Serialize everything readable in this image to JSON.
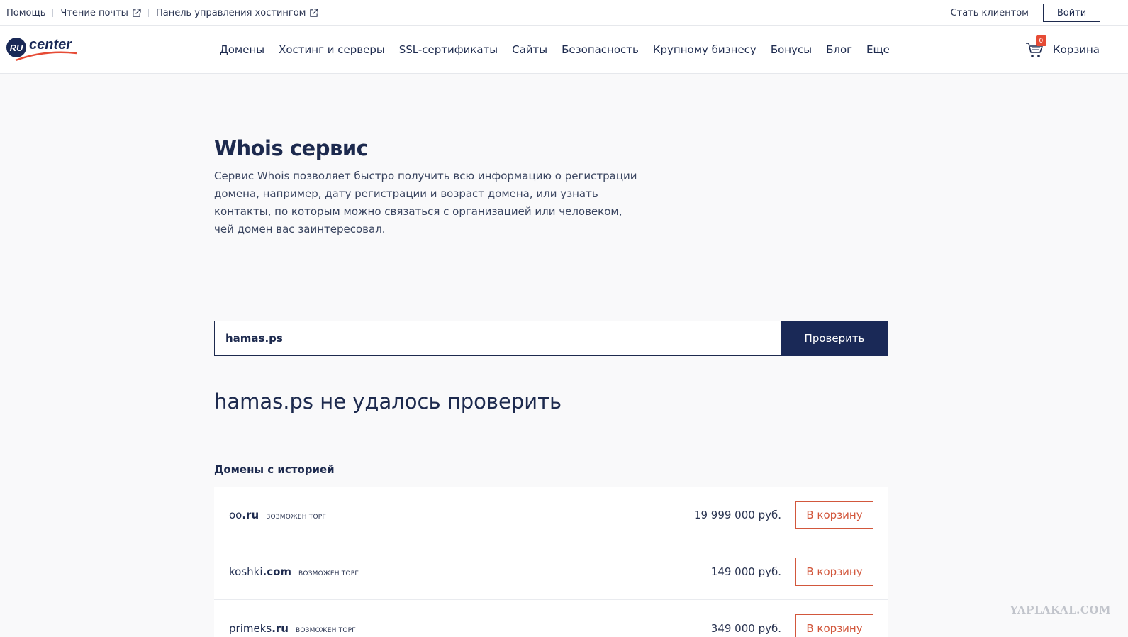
{
  "topbar": {
    "help": "Помощь",
    "mail": "Чтение почты",
    "hosting_panel": "Панель управления хостингом",
    "become_client": "Стать клиентом",
    "login": "Войти"
  },
  "logo": {
    "ru": "RU",
    "center": "center"
  },
  "nav": [
    "Домены",
    "Хостинг и серверы",
    "SSL-сертификаты",
    "Сайты",
    "Безопасность",
    "Крупному бизнесу",
    "Бонусы",
    "Блог",
    "Еще"
  ],
  "cart": {
    "label": "Корзина",
    "count": "0"
  },
  "page": {
    "title": "Whois сервис",
    "description": "Сервис Whois позволяет быстро получить всю информацию о регистрации домена, например, дату регистрации и возраст домена, или узнать контакты, по которым можно связаться с организацией или человеком, чей домен вас заинтересовал."
  },
  "search": {
    "value": "hamas.ps",
    "button": "Проверить"
  },
  "result_title": "hamas.ps не удалось проверить",
  "history_section": {
    "title": "Домены с историей",
    "domains": [
      {
        "name": "oo",
        "zone": ".ru",
        "tag": "ВОЗМОЖЕН ТОРГ",
        "price": "19 999 000 руб.",
        "button": "В корзину"
      },
      {
        "name": "koshki",
        "zone": ".com",
        "tag": "ВОЗМОЖЕН ТОРГ",
        "price": "149 000 руб.",
        "button": "В корзину"
      },
      {
        "name": "primeks",
        "zone": ".ru",
        "tag": "ВОЗМОЖЕН ТОРГ",
        "price": "349 000 руб.",
        "button": "В корзину"
      }
    ]
  },
  "watermark": "YAPLAKAL.COM",
  "colors": {
    "brand_navy": "#1a2957",
    "accent_orange": "#d2573c",
    "badge_red": "#e64b35"
  }
}
